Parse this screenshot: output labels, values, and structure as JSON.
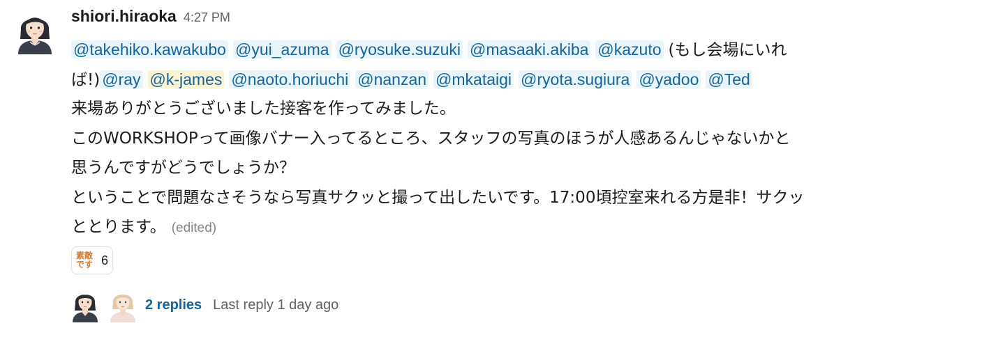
{
  "message": {
    "username": "shiori.hiraoka",
    "timestamp": "4:27 PM",
    "line1": {
      "mentions": [
        "@takehiko.kawakubo",
        "@yui_azuma",
        "@ryosuke.suzuki",
        "@masaaki.akiba",
        "@kazuto"
      ],
      "trailing_text": "(もし会場にいれ"
    },
    "line2": {
      "leading_text": "ば!)",
      "mentions": [
        "@ray",
        "@k-james",
        "@naoto.horiuchi",
        "@nanzan",
        "@mkataigi",
        "@ryota.sugiura",
        "@yadoo",
        "@Ted"
      ],
      "highlighted_mention": "@k-james"
    },
    "line3": "来場ありがとうございました接客を作ってみました。",
    "line4": "このWORKSHOPって画像バナー入ってるところ、スタッフの写真のほうが人感あるんじゃないかと",
    "line5": "思うんですがどうでしょうか？",
    "line6": "ということで問題なさそうなら写真サクッと撮って出したいです。17:00頃控室来れる方是非！サクッ",
    "line7": "ととります。",
    "edited_label": "(edited)"
  },
  "reaction": {
    "emoji_text_top": "素敵",
    "emoji_text_bottom": "です",
    "count": "6"
  },
  "thread": {
    "replies_label": "2 replies",
    "last_reply_label": "Last reply 1 day ago"
  },
  "colors": {
    "mention_text": "#1264a3",
    "mention_bg": "#e8f5fa",
    "self_mention_bg": "#fcf3d0",
    "reaction_emoji": "#d9792b"
  }
}
